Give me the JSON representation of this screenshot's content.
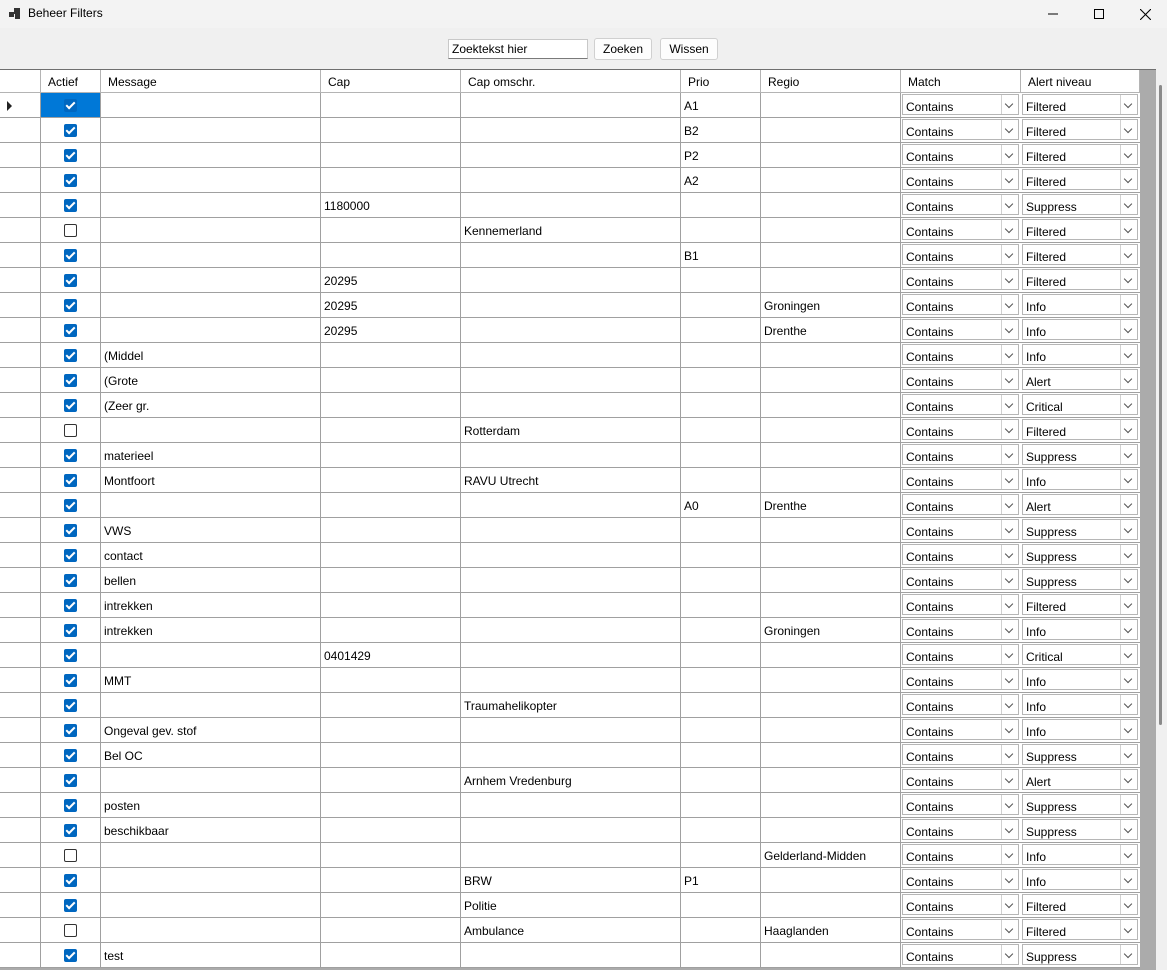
{
  "window": {
    "title": "Beheer Filters"
  },
  "toolbar": {
    "search_value": "Zoektekst hier",
    "search_button": "Zoeken",
    "clear_button": "Wissen"
  },
  "columns": [
    "Actief",
    "Message",
    "Cap",
    "Cap omschr.",
    "Prio",
    "Regio",
    "Match",
    "Alert niveau"
  ],
  "rows": [
    {
      "actief": true,
      "message": "",
      "cap": "",
      "cap_omschr": "",
      "prio": "A1",
      "regio": "",
      "match": "Contains",
      "alert": "Filtered"
    },
    {
      "actief": true,
      "message": "",
      "cap": "",
      "cap_omschr": "",
      "prio": "B2",
      "regio": "",
      "match": "Contains",
      "alert": "Filtered"
    },
    {
      "actief": true,
      "message": "",
      "cap": "",
      "cap_omschr": "",
      "prio": "P2",
      "regio": "",
      "match": "Contains",
      "alert": "Filtered"
    },
    {
      "actief": true,
      "message": "",
      "cap": "",
      "cap_omschr": "",
      "prio": "A2",
      "regio": "",
      "match": "Contains",
      "alert": "Filtered"
    },
    {
      "actief": true,
      "message": "",
      "cap": "1180000",
      "cap_omschr": "",
      "prio": "",
      "regio": "",
      "match": "Contains",
      "alert": "Suppress"
    },
    {
      "actief": false,
      "message": "",
      "cap": "",
      "cap_omschr": "Kennemerland",
      "prio": "",
      "regio": "",
      "match": "Contains",
      "alert": "Filtered"
    },
    {
      "actief": true,
      "message": "",
      "cap": "",
      "cap_omschr": "",
      "prio": "B1",
      "regio": "",
      "match": "Contains",
      "alert": "Filtered"
    },
    {
      "actief": true,
      "message": "",
      "cap": "20295",
      "cap_omschr": "",
      "prio": "",
      "regio": "",
      "match": "Contains",
      "alert": "Filtered"
    },
    {
      "actief": true,
      "message": "",
      "cap": "20295",
      "cap_omschr": "",
      "prio": "",
      "regio": "Groningen",
      "match": "Contains",
      "alert": "Info"
    },
    {
      "actief": true,
      "message": "",
      "cap": "20295",
      "cap_omschr": "",
      "prio": "",
      "regio": "Drenthe",
      "match": "Contains",
      "alert": "Info"
    },
    {
      "actief": true,
      "message": "(Middel",
      "cap": "",
      "cap_omschr": "",
      "prio": "",
      "regio": "",
      "match": "Contains",
      "alert": "Info"
    },
    {
      "actief": true,
      "message": "(Grote",
      "cap": "",
      "cap_omschr": "",
      "prio": "",
      "regio": "",
      "match": "Contains",
      "alert": "Alert"
    },
    {
      "actief": true,
      "message": "(Zeer gr.",
      "cap": "",
      "cap_omschr": "",
      "prio": "",
      "regio": "",
      "match": "Contains",
      "alert": "Critical"
    },
    {
      "actief": false,
      "message": "",
      "cap": "",
      "cap_omschr": "Rotterdam",
      "prio": "",
      "regio": "",
      "match": "Contains",
      "alert": "Filtered"
    },
    {
      "actief": true,
      "message": "materieel",
      "cap": "",
      "cap_omschr": "",
      "prio": "",
      "regio": "",
      "match": "Contains",
      "alert": "Suppress"
    },
    {
      "actief": true,
      "message": "Montfoort",
      "cap": "",
      "cap_omschr": "RAVU Utrecht",
      "prio": "",
      "regio": "",
      "match": "Contains",
      "alert": "Info"
    },
    {
      "actief": true,
      "message": "",
      "cap": "",
      "cap_omschr": "",
      "prio": "A0",
      "regio": "Drenthe",
      "match": "Contains",
      "alert": "Alert"
    },
    {
      "actief": true,
      "message": "VWS",
      "cap": "",
      "cap_omschr": "",
      "prio": "",
      "regio": "",
      "match": "Contains",
      "alert": "Suppress"
    },
    {
      "actief": true,
      "message": "contact",
      "cap": "",
      "cap_omschr": "",
      "prio": "",
      "regio": "",
      "match": "Contains",
      "alert": "Suppress"
    },
    {
      "actief": true,
      "message": "bellen",
      "cap": "",
      "cap_omschr": "",
      "prio": "",
      "regio": "",
      "match": "Contains",
      "alert": "Suppress"
    },
    {
      "actief": true,
      "message": "intrekken",
      "cap": "",
      "cap_omschr": "",
      "prio": "",
      "regio": "",
      "match": "Contains",
      "alert": "Filtered"
    },
    {
      "actief": true,
      "message": "intrekken",
      "cap": "",
      "cap_omschr": "",
      "prio": "",
      "regio": "Groningen",
      "match": "Contains",
      "alert": "Info"
    },
    {
      "actief": true,
      "message": "",
      "cap": "0401429",
      "cap_omschr": "",
      "prio": "",
      "regio": "",
      "match": "Contains",
      "alert": "Critical"
    },
    {
      "actief": true,
      "message": "MMT",
      "cap": "",
      "cap_omschr": "",
      "prio": "",
      "regio": "",
      "match": "Contains",
      "alert": "Info"
    },
    {
      "actief": true,
      "message": "",
      "cap": "",
      "cap_omschr": "Traumahelikopter",
      "prio": "",
      "regio": "",
      "match": "Contains",
      "alert": "Info"
    },
    {
      "actief": true,
      "message": "Ongeval gev. stof",
      "cap": "",
      "cap_omschr": "",
      "prio": "",
      "regio": "",
      "match": "Contains",
      "alert": "Info"
    },
    {
      "actief": true,
      "message": "Bel OC",
      "cap": "",
      "cap_omschr": "",
      "prio": "",
      "regio": "",
      "match": "Contains",
      "alert": "Suppress"
    },
    {
      "actief": true,
      "message": "",
      "cap": "",
      "cap_omschr": "Arnhem Vredenburg",
      "prio": "",
      "regio": "",
      "match": "Contains",
      "alert": "Alert"
    },
    {
      "actief": true,
      "message": "posten",
      "cap": "",
      "cap_omschr": "",
      "prio": "",
      "regio": "",
      "match": "Contains",
      "alert": "Suppress"
    },
    {
      "actief": true,
      "message": "beschikbaar",
      "cap": "",
      "cap_omschr": "",
      "prio": "",
      "regio": "",
      "match": "Contains",
      "alert": "Suppress"
    },
    {
      "actief": false,
      "message": "",
      "cap": "",
      "cap_omschr": "",
      "prio": "",
      "regio": "Gelderland-Midden",
      "match": "Contains",
      "alert": "Info"
    },
    {
      "actief": true,
      "message": "",
      "cap": "",
      "cap_omschr": "BRW",
      "prio": "P1",
      "regio": "",
      "match": "Contains",
      "alert": "Info"
    },
    {
      "actief": true,
      "message": "",
      "cap": "",
      "cap_omschr": "Politie",
      "prio": "",
      "regio": "",
      "match": "Contains",
      "alert": "Filtered"
    },
    {
      "actief": false,
      "message": "",
      "cap": "",
      "cap_omschr": "Ambulance",
      "prio": "",
      "regio": "Haaglanden",
      "match": "Contains",
      "alert": "Filtered"
    },
    {
      "actief": true,
      "message": "test",
      "cap": "",
      "cap_omschr": "",
      "prio": "",
      "regio": "",
      "match": "Contains",
      "alert": "Suppress"
    }
  ],
  "selected_row": 0
}
